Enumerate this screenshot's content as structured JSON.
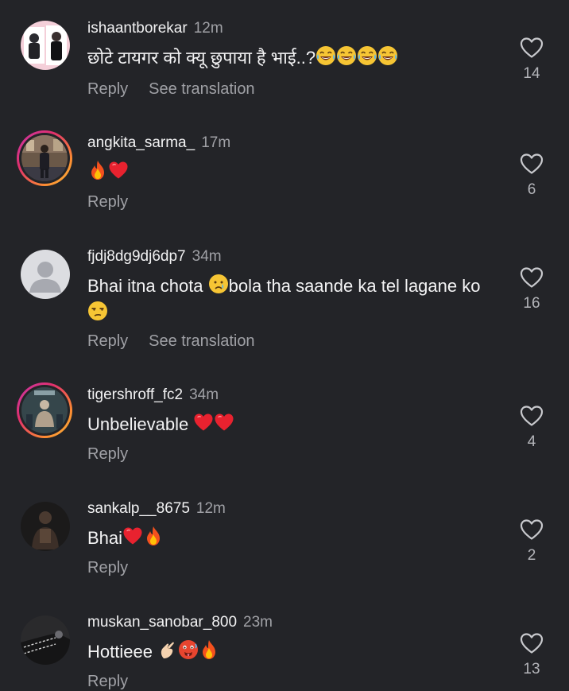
{
  "comments": [
    {
      "username": "ishaantborekar",
      "time": "12m",
      "text": "छोटे टायगर को क्यू छुपाया है भाई..?",
      "emojis": [
        "laughing-tears-emoji",
        "laughing-tears-emoji",
        "laughing-tears-emoji",
        "laughing-tears-emoji"
      ],
      "reply_label": "Reply",
      "translate_label": "See translation",
      "likes": "14"
    },
    {
      "username": "angkita_sarma_",
      "time": "17m",
      "text": "",
      "emojis": [
        "fire-emoji",
        "red-heart-emoji"
      ],
      "reply_label": "Reply",
      "likes": "6"
    },
    {
      "username": "fjdj8dg9dj6dp7",
      "time": "34m",
      "text_part1": "Bhai itna chota ",
      "text_part2": "bola tha saande ka tel lagane ko",
      "emojis": [
        "crying-face-emoji",
        "unamused-face-emoji"
      ],
      "reply_label": "Reply",
      "translate_label": "See translation",
      "likes": "16"
    },
    {
      "username": "tigershroff_fc2",
      "time": "34m",
      "text": "Unbelievable ",
      "emojis": [
        "red-heart-emoji",
        "red-heart-emoji"
      ],
      "reply_label": "Reply",
      "likes": "4"
    },
    {
      "username": "sankalp__8675",
      "time": "12m",
      "text": "Bhai",
      "emojis": [
        "red-heart-emoji",
        "fire-emoji"
      ],
      "reply_label": "Reply",
      "likes": "2"
    },
    {
      "username": "muskan_sanobar_800",
      "time": "23m",
      "text": "Hottieee ",
      "emojis": [
        "pinching-hand-emoji",
        "hot-face-emoji",
        "fire-emoji"
      ],
      "reply_label": "Reply",
      "likes": "13"
    }
  ],
  "colors": {
    "background": "#232428",
    "primary_text": "#f2f2f3",
    "secondary_text": "#a0a1a6",
    "story_ring": "#e1306c"
  }
}
